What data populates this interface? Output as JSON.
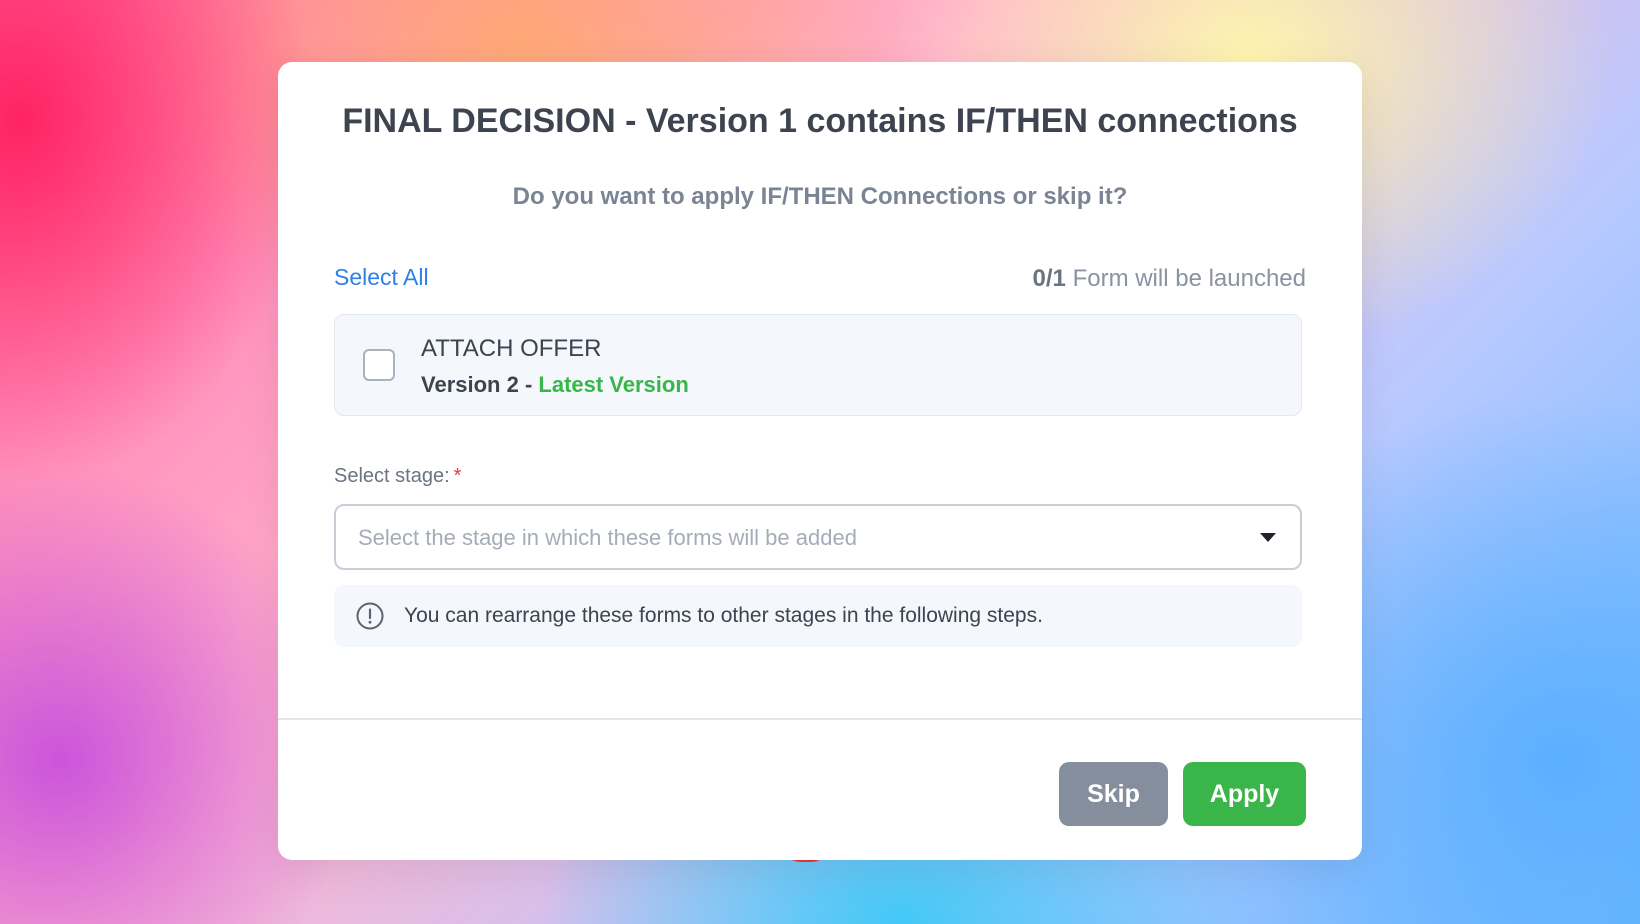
{
  "dialog": {
    "title": "FINAL DECISION - Version 1 contains IF/THEN connections",
    "subtitle": "Do you want to apply IF/THEN Connections or skip it?",
    "select_all_label": "Select All",
    "launch_count": "0/1",
    "launch_suffix": "Form will be launched",
    "forms": [
      {
        "name": "ATTACH OFFER",
        "version_prefix": "Version 2 - ",
        "version_tag": "Latest Version",
        "checked": false
      }
    ],
    "stage": {
      "label": "Select stage:",
      "required_mark": "*",
      "placeholder": "Select the stage in which these forms will be added"
    },
    "info_text": "You can rearrange these forms to other stages in the following steps.",
    "buttons": {
      "skip": "Skip",
      "apply": "Apply"
    }
  },
  "icons": {
    "info": "info-circle-icon",
    "dropdown": "caret-down-icon"
  },
  "colors": {
    "accent_link": "#2f7fe8",
    "success": "#3ab54a",
    "skip_button": "#858e9c",
    "required": "#e83a3a"
  }
}
